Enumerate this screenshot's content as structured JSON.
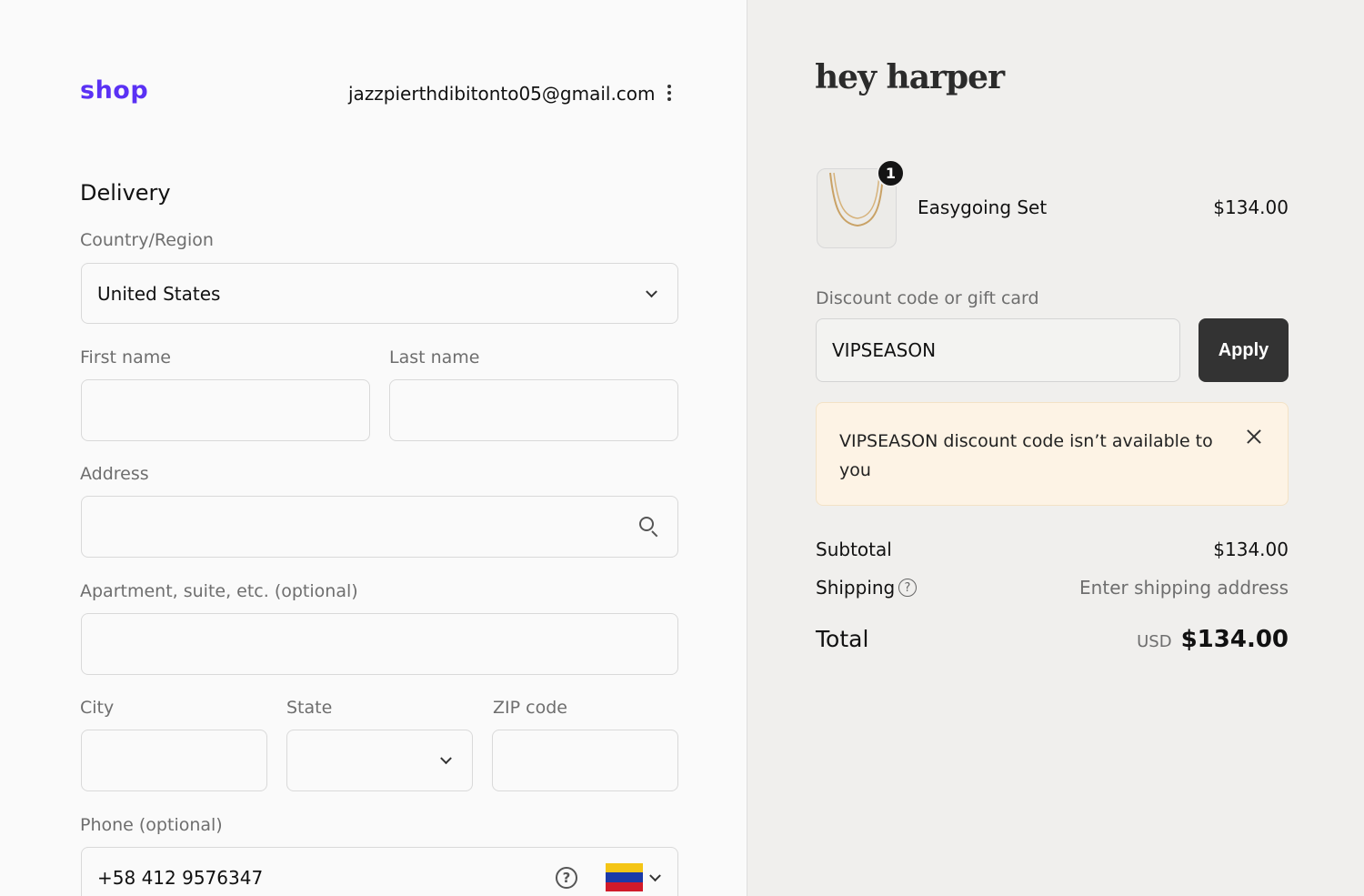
{
  "header": {
    "shop_logo": "shop",
    "account_email": "jazzpierthdibitonto05@gmail.com"
  },
  "delivery": {
    "title": "Delivery",
    "country_label": "Country/Region",
    "country_value": "United States",
    "first_name_label": "First name",
    "first_name_value": "",
    "last_name_label": "Last name",
    "last_name_value": "",
    "address_label": "Address",
    "address_value": "",
    "apartment_label": "Apartment, suite, etc. (optional)",
    "apartment_value": "",
    "city_label": "City",
    "city_value": "",
    "state_label": "State",
    "state_value": "",
    "zip_label": "ZIP code",
    "zip_value": "",
    "phone_label": "Phone (optional)",
    "phone_value": "+58 412 9576347",
    "phone_help": "?",
    "phone_flag": "venezuela-flag"
  },
  "summary": {
    "brand": "hey harper",
    "item": {
      "name": "Easygoing Set",
      "price": "$134.00",
      "quantity": "1"
    },
    "discount_label": "Discount code or gift card",
    "discount_value": "VIPSEASON",
    "apply_label": "Apply",
    "alert_text": "VIPSEASON discount code isn’t available to you",
    "subtotal_label": "Subtotal",
    "subtotal_value": "$134.00",
    "shipping_label": "Shipping",
    "shipping_help": "?",
    "shipping_value": "Enter shipping address",
    "total_label": "Total",
    "total_currency": "USD",
    "total_value": "$134.00"
  },
  "colors": {
    "shop_brand": "#5a31f4",
    "apply_button": "#333333",
    "alert_background": "#fdf3e5",
    "summary_background": "#f0efed"
  }
}
